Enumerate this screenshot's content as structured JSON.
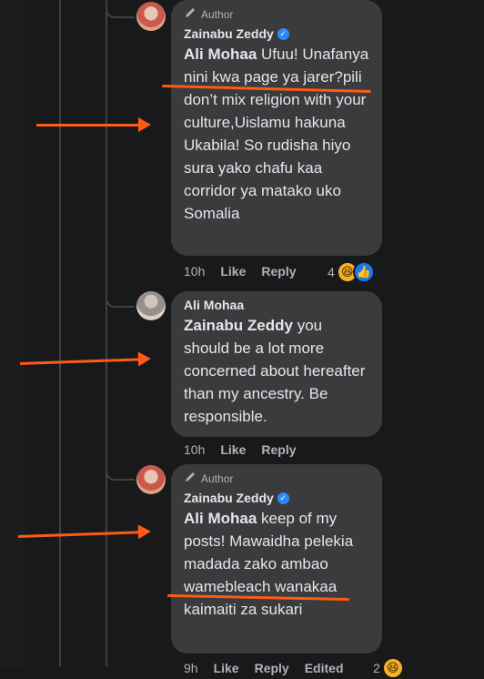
{
  "comments": [
    {
      "badge": "Author",
      "author": "Zainabu Zeddy",
      "mention": "Ali Mohaa",
      "text": " Ufuu! Unafanya nini kwa page ya jarer?pili don’t mix religion with your culture,Uislamu hakuna Ukabila! So rudisha hiyo sura yako chafu kaa corridor ya matako uko Somalia",
      "time": "10h",
      "like": "Like",
      "reply": "Reply",
      "reaction_count": "4"
    },
    {
      "author": "Ali Mohaa",
      "mention": "Zainabu Zeddy",
      "text": " you should be a lot more concerned about hereafter than my ancestry. Be responsible.",
      "time": "10h",
      "like": "Like",
      "reply": "Reply"
    },
    {
      "badge": "Author",
      "author": "Zainabu Zeddy",
      "mention": "Ali Mohaa",
      "text": " keep of my posts! Mawaidha pelekia madada zako ambao wamebleach wanakaa kaimaiti za sukari",
      "time": "9h",
      "like": "Like",
      "reply": "Reply",
      "edited": "Edited",
      "reaction_count": "2"
    }
  ],
  "icons": {
    "author_badge": "pencil-icon",
    "verified": "verified-check-icon",
    "reaction_laugh": "laughing-emoji",
    "reaction_like": "thumbs-up"
  },
  "colors": {
    "background": "#18191a",
    "bubble": "#3a3b3c",
    "annotation": "#ff5a17",
    "verified": "#2d88ff"
  }
}
